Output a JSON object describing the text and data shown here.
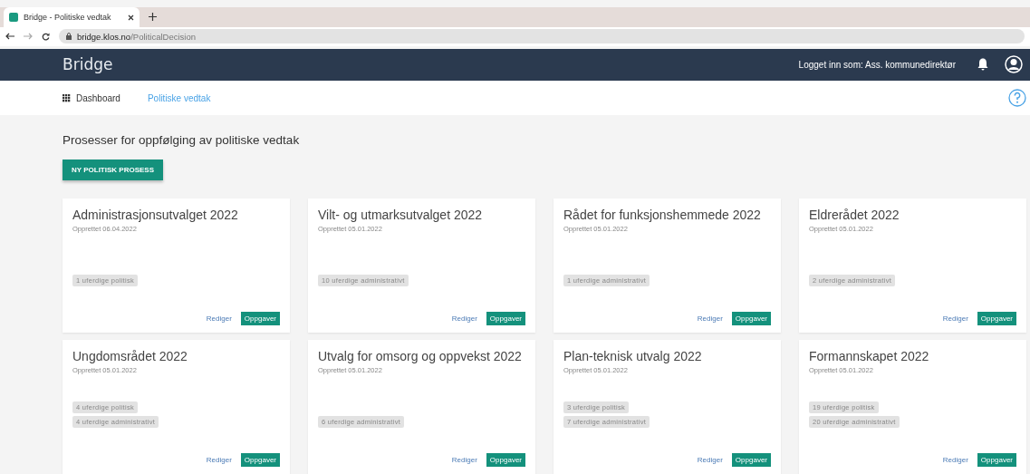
{
  "browser": {
    "tab_title": "Bridge - Politiske vedtak",
    "url_host": "bridge.klos.no",
    "url_path": "/PoliticalDecision"
  },
  "header": {
    "brand": "Bridge",
    "user": "Logget inn som: Ass. kommunedirektør"
  },
  "nav": [
    {
      "label": "Dashboard",
      "selected": false
    },
    {
      "label": "Politiske vedtak",
      "selected": true
    }
  ],
  "page_title": "Prosesser for oppfølging av politiske vedtak",
  "new_button": "NY POLITISK PROSESS",
  "cards": [
    {
      "title": "Administrasjonsutvalget 2022",
      "created": "Opprettet 06.04.2022",
      "tags": [
        "1 uferdige politisk"
      ],
      "edit": "Rediger",
      "tasks": "Oppgaver"
    },
    {
      "title": "Vilt- og utmarksutvalget 2022",
      "created": "Opprettet 05.01.2022",
      "tags": [
        "10 uferdige administrativt"
      ],
      "edit": "Rediger",
      "tasks": "Oppgaver"
    },
    {
      "title": "Rådet for funksjonshemmede 2022",
      "created": "Opprettet 05.01.2022",
      "tags": [
        "1 uferdige administrativt"
      ],
      "edit": "Rediger",
      "tasks": "Oppgaver"
    },
    {
      "title": "Eldrerådet 2022",
      "created": "Opprettet 05.01.2022",
      "tags": [
        "2 uferdige administrativt"
      ],
      "edit": "Rediger",
      "tasks": "Oppgaver"
    },
    {
      "title": "Ungdomsrådet 2022",
      "created": "Opprettet 05.01.2022",
      "tags": [
        "4 uferdige politisk",
        "4 uferdige administrativt"
      ],
      "edit": "Rediger",
      "tasks": "Oppgaver"
    },
    {
      "title": "Utvalg for omsorg og oppvekst 2022",
      "created": "Opprettet 05.01.2022",
      "tags": [
        "6 uferdige administrativt"
      ],
      "edit": "Rediger",
      "tasks": "Oppgaver"
    },
    {
      "title": "Plan-teknisk utvalg 2022",
      "created": "Opprettet 05.01.2022",
      "tags": [
        "3 uferdige politisk",
        "7 uferdige administrativt"
      ],
      "edit": "Rediger",
      "tasks": "Oppgaver"
    },
    {
      "title": "Formannskapet 2022",
      "created": "Opprettet 05.01.2022",
      "tags": [
        "19 uferdige politisk",
        "20 uferdige administrativt"
      ],
      "edit": "Rediger",
      "tasks": "Oppgaver"
    }
  ]
}
